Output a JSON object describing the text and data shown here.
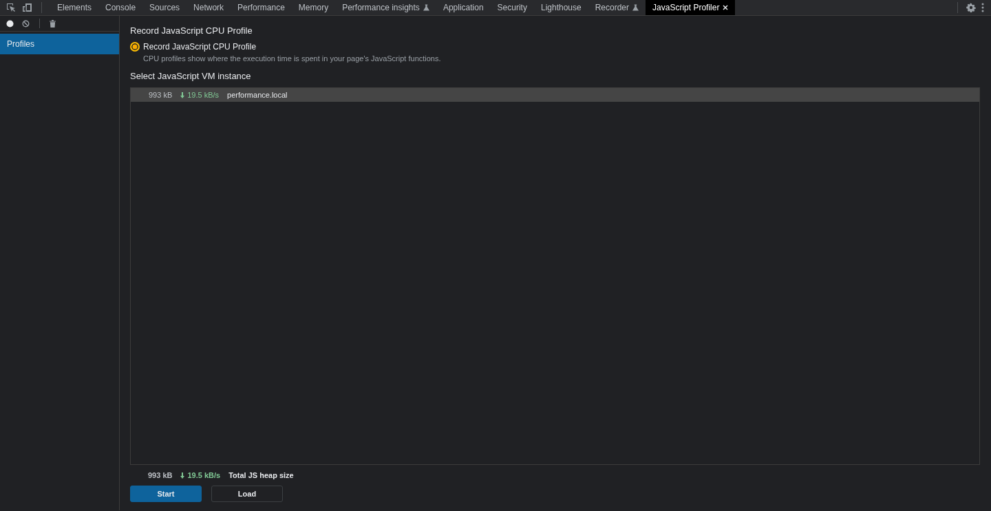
{
  "tabs": [
    {
      "label": "Elements",
      "selected": false,
      "experimental": false,
      "closable": false
    },
    {
      "label": "Console",
      "selected": false,
      "experimental": false,
      "closable": false
    },
    {
      "label": "Sources",
      "selected": false,
      "experimental": false,
      "closable": false
    },
    {
      "label": "Network",
      "selected": false,
      "experimental": false,
      "closable": false
    },
    {
      "label": "Performance",
      "selected": false,
      "experimental": false,
      "closable": false
    },
    {
      "label": "Memory",
      "selected": false,
      "experimental": false,
      "closable": false
    },
    {
      "label": "Performance insights",
      "selected": false,
      "experimental": true,
      "closable": false
    },
    {
      "label": "Application",
      "selected": false,
      "experimental": false,
      "closable": false
    },
    {
      "label": "Security",
      "selected": false,
      "experimental": false,
      "closable": false
    },
    {
      "label": "Lighthouse",
      "selected": false,
      "experimental": false,
      "closable": false
    },
    {
      "label": "Recorder",
      "selected": false,
      "experimental": true,
      "closable": false
    },
    {
      "label": "JavaScript Profiler",
      "selected": true,
      "experimental": false,
      "closable": true
    }
  ],
  "sidebar": {
    "items": [
      {
        "label": "Profiles",
        "selected": true
      }
    ]
  },
  "profile_type": {
    "heading": "Record JavaScript CPU Profile",
    "options": [
      {
        "label": "Record JavaScript CPU Profile",
        "description": "CPU profiles show where the execution time is spent in your page's JavaScript functions.",
        "selected": true
      }
    ]
  },
  "vm_instances": {
    "heading": "Select JavaScript VM instance",
    "rows": [
      {
        "size": "993 kB",
        "rate": "19.5 kB/s",
        "name": "performance.local",
        "selected": true
      }
    ]
  },
  "summary": {
    "size": "993 kB",
    "rate": "19.5 kB/s",
    "label": "Total JS heap size"
  },
  "buttons": [
    {
      "label": "Start",
      "kind": "primary"
    },
    {
      "label": "Load",
      "kind": "secondary"
    }
  ]
}
